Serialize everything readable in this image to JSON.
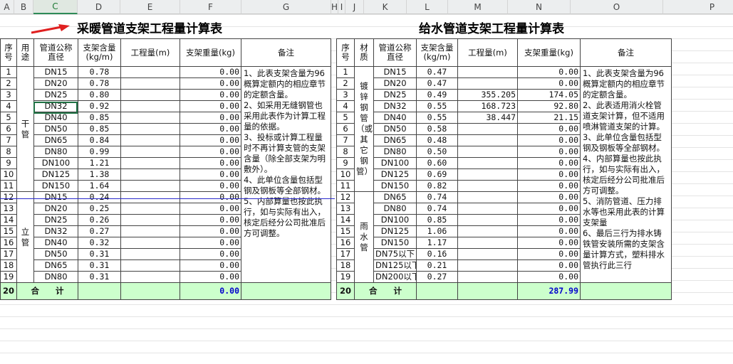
{
  "columns": [
    "A",
    "B",
    "C",
    "D",
    "E",
    "F",
    "G",
    "H",
    "I",
    "J",
    "K",
    "L",
    "M",
    "N",
    "O",
    "P"
  ],
  "selected_column": "C",
  "left": {
    "title": "采暖管道支架工程量计算表",
    "headers": {
      "no": "序号",
      "use": "用途",
      "dia": "管道公称直径",
      "content": "支架含量(kg/m)",
      "qty": "工程量(m)",
      "weight": "支架重量(kg)",
      "note": "备注"
    },
    "group1": "干管",
    "group2": "立管",
    "rows": [
      {
        "no": "1",
        "dia": "DN15",
        "content": "0.78",
        "qty": "",
        "weight": "0.00"
      },
      {
        "no": "2",
        "dia": "DN20",
        "content": "0.78",
        "qty": "",
        "weight": "0.00"
      },
      {
        "no": "3",
        "dia": "DN25",
        "content": "0.80",
        "qty": "",
        "weight": "0.00"
      },
      {
        "no": "4",
        "dia": "DN32",
        "content": "0.92",
        "qty": "",
        "weight": "0.00"
      },
      {
        "no": "5",
        "dia": "DN40",
        "content": "0.85",
        "qty": "",
        "weight": "0.00"
      },
      {
        "no": "6",
        "dia": "DN50",
        "content": "0.85",
        "qty": "",
        "weight": "0.00"
      },
      {
        "no": "7",
        "dia": "DN65",
        "content": "0.84",
        "qty": "",
        "weight": "0.00"
      },
      {
        "no": "8",
        "dia": "DN80",
        "content": "0.99",
        "qty": "",
        "weight": "0.00"
      },
      {
        "no": "9",
        "dia": "DN100",
        "content": "1.21",
        "qty": "",
        "weight": "0.00"
      },
      {
        "no": "10",
        "dia": "DN125",
        "content": "1.38",
        "qty": "",
        "weight": "0.00"
      },
      {
        "no": "11",
        "dia": "DN150",
        "content": "1.64",
        "qty": "",
        "weight": "0.00"
      },
      {
        "no": "12",
        "dia": "DN15",
        "content": "0.24",
        "qty": "",
        "weight": "0.00"
      },
      {
        "no": "13",
        "dia": "DN20",
        "content": "0.25",
        "qty": "",
        "weight": "0.00"
      },
      {
        "no": "14",
        "dia": "DN25",
        "content": "0.26",
        "qty": "",
        "weight": "0.00"
      },
      {
        "no": "15",
        "dia": "DN32",
        "content": "0.27",
        "qty": "",
        "weight": "0.00"
      },
      {
        "no": "16",
        "dia": "DN40",
        "content": "0.32",
        "qty": "",
        "weight": "0.00"
      },
      {
        "no": "17",
        "dia": "DN50",
        "content": "0.31",
        "qty": "",
        "weight": "0.00"
      },
      {
        "no": "18",
        "dia": "DN65",
        "content": "0.31",
        "qty": "",
        "weight": "0.00"
      },
      {
        "no": "19",
        "dia": "DN80",
        "content": "0.31",
        "qty": "",
        "weight": "0.00"
      }
    ],
    "total": {
      "no": "20",
      "label": "合　　计",
      "weight": "0.00"
    },
    "note": "1、此表支架含量为96概算定额内的相应章节的定额含量。\n2、如采用无缝钢管也采用此表作为计算工程量的依据。\n3、投标或计算工程量时不再计算支管的支架含量（除全部支架为明敷外）。\n4、此单位含量包括型钢及钢板等全部钢材。\n5、内部算量也按此执行，如与实际有出入，核定后经分公司批准后方可调整。"
  },
  "right": {
    "title": "给水管道支架工程量计算表",
    "headers": {
      "no": "序号",
      "material": "材质",
      "dia": "管道公称直径",
      "content": "支架含量(kg/m)",
      "qty": "工程量(m)",
      "weight": "支架重量(kg)",
      "note": "备注"
    },
    "group1": "镀锌钢管（或其它钢管）",
    "group2": "雨水管",
    "rows": [
      {
        "no": "1",
        "dia": "DN15",
        "content": "0.47",
        "qty": "",
        "weight": "0.00"
      },
      {
        "no": "2",
        "dia": "DN20",
        "content": "0.47",
        "qty": "",
        "weight": "0.00"
      },
      {
        "no": "3",
        "dia": "DN25",
        "content": "0.49",
        "qty": "355.205",
        "weight": "174.05"
      },
      {
        "no": "4",
        "dia": "DN32",
        "content": "0.55",
        "qty": "168.723",
        "weight": "92.80"
      },
      {
        "no": "5",
        "dia": "DN40",
        "content": "0.55",
        "qty": "38.447",
        "weight": "21.15"
      },
      {
        "no": "6",
        "dia": "DN50",
        "content": "0.58",
        "qty": "",
        "weight": "0.00"
      },
      {
        "no": "7",
        "dia": "DN65",
        "content": "0.48",
        "qty": "",
        "weight": "0.00"
      },
      {
        "no": "8",
        "dia": "DN80",
        "content": "0.50",
        "qty": "",
        "weight": "0.00"
      },
      {
        "no": "9",
        "dia": "DN100",
        "content": "0.60",
        "qty": "",
        "weight": "0.00"
      },
      {
        "no": "10",
        "dia": "DN125",
        "content": "0.69",
        "qty": "",
        "weight": "0.00"
      },
      {
        "no": "11",
        "dia": "DN150",
        "content": "0.82",
        "qty": "",
        "weight": "0.00"
      },
      {
        "no": "12",
        "dia": "DN65",
        "content": "0.74",
        "qty": "",
        "weight": "0.00"
      },
      {
        "no": "13",
        "dia": "DN80",
        "content": "0.74",
        "qty": "",
        "weight": "0.00"
      },
      {
        "no": "14",
        "dia": "DN100",
        "content": "0.85",
        "qty": "",
        "weight": "0.00"
      },
      {
        "no": "15",
        "dia": "DN125",
        "content": "1.06",
        "qty": "",
        "weight": "0.00"
      },
      {
        "no": "16",
        "dia": "DN150",
        "content": "1.17",
        "qty": "",
        "weight": "0.00"
      },
      {
        "no": "17",
        "dia": "DN75以下",
        "content": "0.16",
        "qty": "",
        "weight": "0.00"
      },
      {
        "no": "18",
        "dia": "DN125以下",
        "content": "0.21",
        "qty": "",
        "weight": "0.00"
      },
      {
        "no": "19",
        "dia": "DN200以下",
        "content": "0.27",
        "qty": "",
        "weight": "0.00"
      }
    ],
    "total": {
      "no": "20",
      "label": "合　　计",
      "weight": "287.99"
    },
    "note": "1、此表支架含量为96概算定额内的相应章节的定额含量。\n2、此表适用消火栓管道支架计算，但不适用喷淋管道支架的计算。\n3、此单位含量包括型钢及钢板等全部钢材。\n4、内部算量也按此执行，如与实际有出入，核定后经分公司批准后方可调整。\n5、消防管道、压力排水等也采用此表的计算支架量\n6、最后三行为排水铸铁管安装所需的支架含量计算方式，塑料排水管执行此三行"
  },
  "colors": {
    "total_bg": "#ccffcc",
    "total_value": "#0000cc",
    "arrow": "#e02020",
    "selection": "#217346"
  }
}
